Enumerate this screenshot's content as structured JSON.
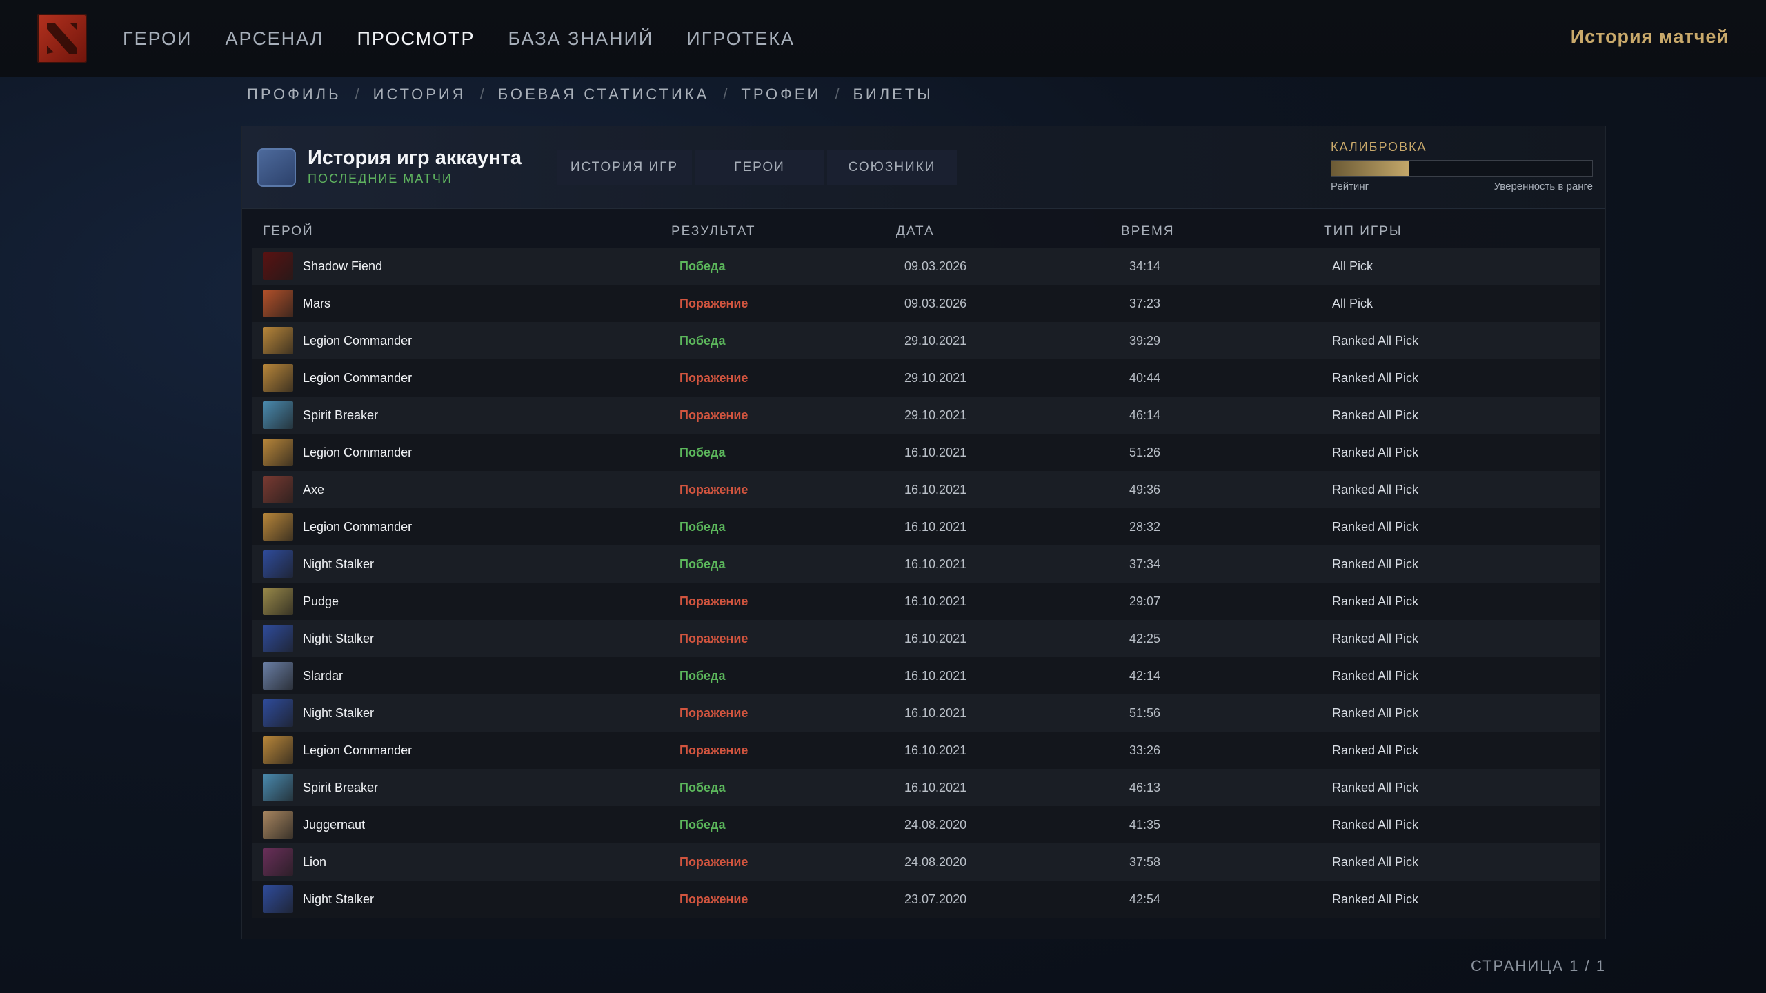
{
  "top_nav": {
    "items": [
      {
        "label": "ГЕРОИ",
        "active": false
      },
      {
        "label": "АРСЕНАЛ",
        "active": false
      },
      {
        "label": "ПРОСМОТР",
        "active": true
      },
      {
        "label": "БАЗА ЗНАНИЙ",
        "active": false
      },
      {
        "label": "ИГРОТЕКА",
        "active": false
      }
    ],
    "right_title": "История матчей"
  },
  "sub_nav": {
    "items": [
      "ПРОФИЛЬ",
      "ИСТОРИЯ",
      "БОЕВАЯ СТАТИСТИКА",
      "ТРОФЕИ",
      "БИЛЕТЫ"
    ],
    "separator": "/"
  },
  "panel": {
    "title": "История игр аккаунта",
    "subtitle": "ПОСЛЕДНИЕ МАТЧИ",
    "tabs": [
      {
        "label": "ИСТОРИЯ ИГР",
        "active": true
      },
      {
        "label": "ГЕРОИ",
        "active": false
      },
      {
        "label": "СОЮЗНИКИ",
        "active": false
      }
    ],
    "calibration": {
      "label": "КАЛИБРОВКА",
      "progress": 0.3,
      "left_caption": "Рейтинг",
      "right_caption": "Уверенность в ранге"
    }
  },
  "table": {
    "columns": [
      "ГЕРОЙ",
      "РЕЗУЛЬТАТ",
      "ДАТА",
      "ВРЕМЯ",
      "ТИП ИГРЫ"
    ],
    "rows": [
      {
        "hero": "Shadow Fiend",
        "result": "Победа",
        "win": true,
        "date": "09.03.2026",
        "duration": "34:14",
        "mode": "All Pick",
        "color": "#5a1212"
      },
      {
        "hero": "Mars",
        "result": "Поражение",
        "win": false,
        "date": "09.03.2026",
        "duration": "37:23",
        "mode": "All Pick",
        "color": "#b4512a"
      },
      {
        "hero": "Legion Commander",
        "result": "Победа",
        "win": true,
        "date": "29.10.2021",
        "duration": "39:29",
        "mode": "Ranked All Pick",
        "color": "#b9873a"
      },
      {
        "hero": "Legion Commander",
        "result": "Поражение",
        "win": false,
        "date": "29.10.2021",
        "duration": "40:44",
        "mode": "Ranked All Pick",
        "color": "#b9873a"
      },
      {
        "hero": "Spirit Breaker",
        "result": "Поражение",
        "win": false,
        "date": "29.10.2021",
        "duration": "46:14",
        "mode": "Ranked All Pick",
        "color": "#4a8bb0"
      },
      {
        "hero": "Legion Commander",
        "result": "Победа",
        "win": true,
        "date": "16.10.2021",
        "duration": "51:26",
        "mode": "Ranked All Pick",
        "color": "#b9873a"
      },
      {
        "hero": "Axe",
        "result": "Поражение",
        "win": false,
        "date": "16.10.2021",
        "duration": "49:36",
        "mode": "Ranked All Pick",
        "color": "#7a3a32"
      },
      {
        "hero": "Legion Commander",
        "result": "Победа",
        "win": true,
        "date": "16.10.2021",
        "duration": "28:32",
        "mode": "Ranked All Pick",
        "color": "#b9873a"
      },
      {
        "hero": "Night Stalker",
        "result": "Победа",
        "win": true,
        "date": "16.10.2021",
        "duration": "37:34",
        "mode": "Ranked All Pick",
        "color": "#2f4c9c"
      },
      {
        "hero": "Pudge",
        "result": "Поражение",
        "win": false,
        "date": "16.10.2021",
        "duration": "29:07",
        "mode": "Ranked All Pick",
        "color": "#9a8a4a"
      },
      {
        "hero": "Night Stalker",
        "result": "Поражение",
        "win": false,
        "date": "16.10.2021",
        "duration": "42:25",
        "mode": "Ranked All Pick",
        "color": "#2f4c9c"
      },
      {
        "hero": "Slardar",
        "result": "Победа",
        "win": true,
        "date": "16.10.2021",
        "duration": "42:14",
        "mode": "Ranked All Pick",
        "color": "#6a7fa6"
      },
      {
        "hero": "Night Stalker",
        "result": "Поражение",
        "win": false,
        "date": "16.10.2021",
        "duration": "51:56",
        "mode": "Ranked All Pick",
        "color": "#2f4c9c"
      },
      {
        "hero": "Legion Commander",
        "result": "Поражение",
        "win": false,
        "date": "16.10.2021",
        "duration": "33:26",
        "mode": "Ranked All Pick",
        "color": "#b9873a"
      },
      {
        "hero": "Spirit Breaker",
        "result": "Победа",
        "win": true,
        "date": "16.10.2021",
        "duration": "46:13",
        "mode": "Ranked All Pick",
        "color": "#4a8bb0"
      },
      {
        "hero": "Juggernaut",
        "result": "Победа",
        "win": true,
        "date": "24.08.2020",
        "duration": "41:35",
        "mode": "Ranked All Pick",
        "color": "#a88660"
      },
      {
        "hero": "Lion",
        "result": "Поражение",
        "win": false,
        "date": "24.08.2020",
        "duration": "37:58",
        "mode": "Ranked All Pick",
        "color": "#6a2f5a"
      },
      {
        "hero": "Night Stalker",
        "result": "Поражение",
        "win": false,
        "date": "23.07.2020",
        "duration": "42:54",
        "mode": "Ranked All Pick",
        "color": "#2f4c9c"
      }
    ]
  },
  "pager": {
    "label": "СТРАНИЦА 1 / 1"
  }
}
